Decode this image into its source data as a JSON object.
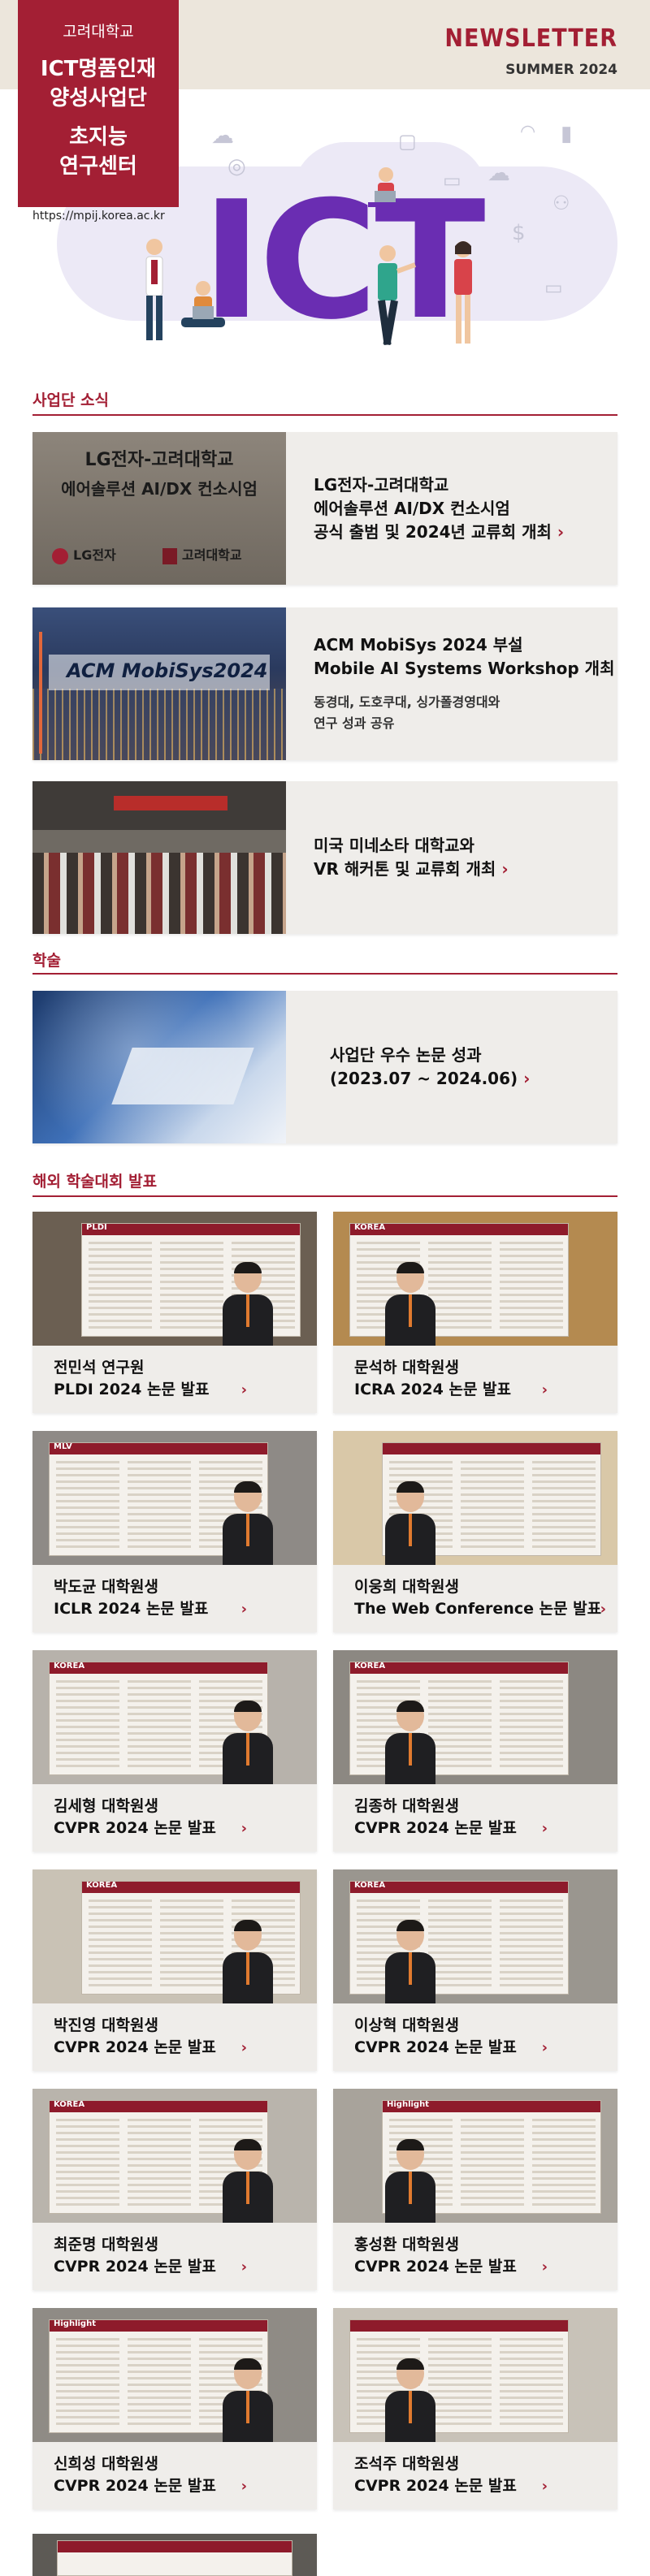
{
  "header": {
    "university": "고려대학교",
    "program": "ICT명품인재\n양성사업단",
    "center": "초지능\n연구센터",
    "url": "https://mpij.korea.ac.kr",
    "newsletter": "NEWSLETTER",
    "issue": "SUMMER 2024",
    "hero_text": "ICT"
  },
  "sections": {
    "news": "사업단 소식",
    "academic": "학술",
    "conferences": "해외 학술대회 발표"
  },
  "news_cards": [
    {
      "image_caption_1": "LG전자-고려대학교",
      "image_caption_2": "에어솔루션 AI/DX 컨소시엄",
      "image_logo_1": "LG전자",
      "image_logo_2": "고려대학교",
      "headline": "LG전자-고려대학교\n에어솔루션 AI/DX 컨소시엄\n공식 출범 및 2024년 교류회 개최",
      "sub": ""
    },
    {
      "image_caption_1": "ACM MobiSys2024",
      "headline": "ACM MobiSys 2024 부설\nMobile AI Systems Workshop 개최",
      "sub": "동경대, 도호쿠대, 싱가폴경영대와\n연구 성과 공유"
    },
    {
      "headline": "미국 미네소타 대학교와\nVR 해커톤 및 교류회 개최",
      "sub": ""
    }
  ],
  "academic_card": {
    "headline": "사업단 우수 논문 성과\n(2023.07 ~ 2024.06)"
  },
  "presentations": [
    {
      "name": "전민석 연구원",
      "paper": "PLDI 2024 논문 발표",
      "poster_note": "PLDI"
    },
    {
      "name": "문석하 대학원생",
      "paper": "ICRA 2024 논문 발표",
      "poster_note": "KOREA"
    },
    {
      "name": "박도균 대학원생",
      "paper": "ICLR 2024 논문 발표",
      "poster_note": "MLV"
    },
    {
      "name": "이웅희 대학원생",
      "paper": "The Web Conference 논문 발표",
      "poster_note": ""
    },
    {
      "name": "김세형 대학원생",
      "paper": "CVPR 2024 논문 발표",
      "poster_note": "KOREA"
    },
    {
      "name": "김종하 대학원생",
      "paper": "CVPR 2024 논문 발표",
      "poster_note": "KOREA"
    },
    {
      "name": "박진영 대학원생",
      "paper": "CVPR 2024 논문 발표",
      "poster_note": "KOREA"
    },
    {
      "name": "이상혁 대학원생",
      "paper": "CVPR 2024 논문 발표",
      "poster_note": "KOREA"
    },
    {
      "name": "최준명 대학원생",
      "paper": "CVPR 2024 논문 발표",
      "poster_note": "KOREA"
    },
    {
      "name": "홍성환 대학원생",
      "paper": "CVPR 2024 논문 발표",
      "poster_note": "Highlight"
    },
    {
      "name": "신희성 대학원생",
      "paper": "CVPR 2024 논문 발표",
      "poster_note": "Highlight"
    },
    {
      "name": "조석주 대학원생",
      "paper": "CVPR 2024 논문 발표",
      "poster_note": ""
    }
  ],
  "colors": {
    "accent": "#a31f34",
    "hero_purple": "#6a2db2",
    "card_bg": "#efedea",
    "band": "#ece6dc"
  },
  "icons": [
    "chevron-right-icon",
    "cloud-icon",
    "lock-icon",
    "globe-icon",
    "wifi-icon",
    "bar-chart-icon",
    "dollar-icon",
    "people-icon",
    "monitor-icon",
    "chat-icon"
  ]
}
